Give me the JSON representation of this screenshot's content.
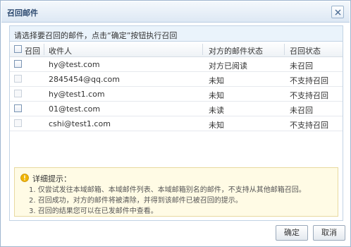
{
  "dialog": {
    "title": "召回邮件",
    "close_icon": "close-icon"
  },
  "instruction": "请选择要召回的邮件，点击“确定”按钮执行召回",
  "table": {
    "headers": {
      "recall": "召回",
      "recipient": "收件人",
      "status": "对方的邮件状态",
      "recall_status": "召回状态"
    },
    "rows": [
      {
        "recipient": "hy@test.com",
        "status": "对方已阅读",
        "recall_status": "未召回",
        "checkbox_enabled": true
      },
      {
        "recipient": "2845454@qq.com",
        "status": "未知",
        "recall_status": "不支持召回",
        "checkbox_enabled": false
      },
      {
        "recipient": "hy@test1.com",
        "status": "未知",
        "recall_status": "不支持召回",
        "checkbox_enabled": false
      },
      {
        "recipient": "01@test.com",
        "status": "未读",
        "recall_status": "未召回",
        "checkbox_enabled": true
      },
      {
        "recipient": "cshi@test1.com",
        "status": "未知",
        "recall_status": "不支持召回",
        "checkbox_enabled": false
      }
    ]
  },
  "tips": {
    "title": "详细提示：",
    "icon": "warning-icon",
    "lines": [
      "1. 仅尝试发往本域邮箱、本域邮件列表、本域邮箱别名的邮件，不支持从其他邮箱召回。",
      "2. 召回成功，对方的邮件将被清除，并得到该邮件已被召回的提示。",
      "3. 召回的结果您可以在已发邮件中查看。"
    ]
  },
  "buttons": {
    "ok": "确定",
    "cancel": "取消"
  },
  "colors": {
    "title_bar": "#dde8f4",
    "instruction_bg": "#eaf3fb",
    "tips_bg": "#fffbe5",
    "warning_icon": "#f0b400"
  }
}
